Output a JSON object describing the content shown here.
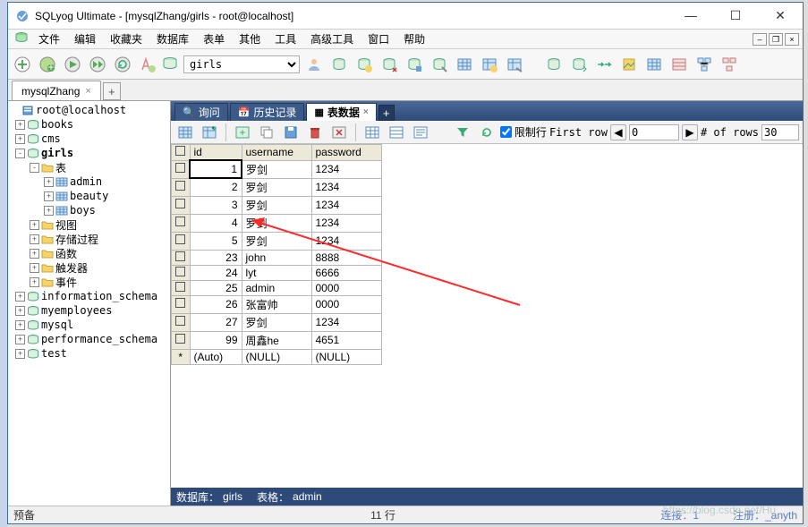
{
  "title": "SQLyog Ultimate - [mysqlZhang/girls - root@localhost]",
  "menu": [
    "文件",
    "编辑",
    "收藏夹",
    "数据库",
    "表单",
    "其他",
    "工具",
    "高级工具",
    "窗口",
    "帮助"
  ],
  "db_selector": "girls",
  "conn_tab": "mysqlZhang",
  "tree": {
    "root": "root@localhost",
    "dbs": [
      {
        "name": "books",
        "exp": "+"
      },
      {
        "name": "cms",
        "exp": "+"
      },
      {
        "name": "girls",
        "exp": "-",
        "bold": true,
        "children": [
          {
            "name": "表",
            "exp": "-",
            "icon": "folder",
            "children": [
              {
                "name": "admin",
                "exp": "+",
                "icon": "table"
              },
              {
                "name": "beauty",
                "exp": "+",
                "icon": "table"
              },
              {
                "name": "boys",
                "exp": "+",
                "icon": "table"
              }
            ]
          },
          {
            "name": "视图",
            "exp": "+",
            "icon": "folder"
          },
          {
            "name": "存储过程",
            "exp": "+",
            "icon": "folder"
          },
          {
            "name": "函数",
            "exp": "+",
            "icon": "folder"
          },
          {
            "name": "触发器",
            "exp": "+",
            "icon": "folder"
          },
          {
            "name": "事件",
            "exp": "+",
            "icon": "folder"
          }
        ]
      },
      {
        "name": "information_schema",
        "exp": "+"
      },
      {
        "name": "myemployees",
        "exp": "+"
      },
      {
        "name": "mysql",
        "exp": "+"
      },
      {
        "name": "performance_schema",
        "exp": "+"
      },
      {
        "name": "test",
        "exp": "+"
      }
    ]
  },
  "result_tabs": [
    {
      "label": "询问",
      "icon": "query-icon"
    },
    {
      "label": "历史记录",
      "icon": "history-icon"
    },
    {
      "label": "表数据",
      "icon": "tabledata-icon",
      "active": true
    }
  ],
  "limit_label": "限制行",
  "first_row_label": "First row",
  "first_row_value": "0",
  "num_rows_label": "# of rows",
  "num_rows_value": "30",
  "grid": {
    "cols": [
      "id",
      "username",
      "password"
    ],
    "rows": [
      {
        "id": "1",
        "username": "罗剑",
        "password": "1234",
        "cur": true
      },
      {
        "id": "2",
        "username": "罗剑",
        "password": "1234"
      },
      {
        "id": "3",
        "username": "罗剑",
        "password": "1234"
      },
      {
        "id": "4",
        "username": "罗剑",
        "password": "1234"
      },
      {
        "id": "5",
        "username": "罗剑",
        "password": "1234"
      },
      {
        "id": "23",
        "username": "john",
        "password": "8888"
      },
      {
        "id": "24",
        "username": "lyt",
        "password": "6666"
      },
      {
        "id": "25",
        "username": "admin",
        "password": "0000"
      },
      {
        "id": "26",
        "username": "张富帅",
        "password": "0000"
      },
      {
        "id": "27",
        "username": "罗剑",
        "password": "1234"
      },
      {
        "id": "99",
        "username": "周鑫he",
        "password": "4651"
      }
    ],
    "newrow": {
      "mark": "*",
      "id": "(Auto)",
      "username": "(NULL)",
      "password": "(NULL)"
    }
  },
  "content_status": {
    "db_lbl": "数据库：",
    "db": "girls",
    "tbl_lbl": "表格：",
    "tbl": "admin"
  },
  "status": {
    "left": "预备",
    "center": "11 行",
    "conn": "连接：1",
    "reg": "注册：_anyth"
  },
  "watermark": "https://blog.csdn.net/Hu"
}
